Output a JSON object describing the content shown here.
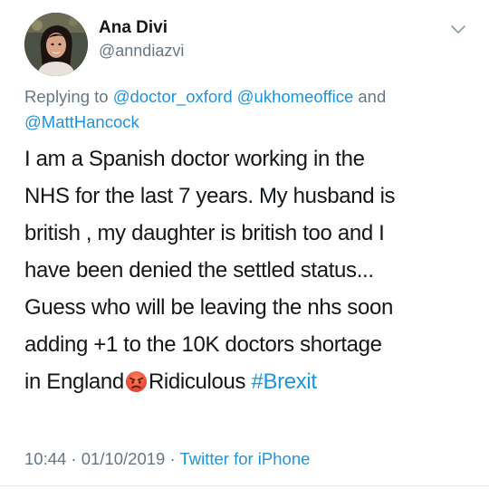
{
  "tweet": {
    "author": {
      "display_name": "Ana Divi",
      "handle": "@anndiazvi",
      "avatar_icon": "profile-photo"
    },
    "menu_icon": "chevron-down-icon",
    "reply": {
      "prefix": "Replying to ",
      "mentions": [
        "@doctor_oxford",
        "@ukhomeoffice",
        "@MattHancock"
      ],
      "separator_1": " ",
      "separator_2": " and",
      "accent_color": "#1b95e0"
    },
    "body_lines": [
      "I am a Spanish doctor working in the",
      "NHS for the last 7 years. My husband is",
      "british , my daughter is british too and I",
      "have been denied the settled status...",
      "Guess who will be leaving the nhs soon",
      "adding +1 to the 10K doctors shortage"
    ],
    "last_line": {
      "before_emoji": "in England",
      "emoji": "angry-face-emoji",
      "after_emoji": "Ridiculous ",
      "hashtag": "#Brexit"
    },
    "meta": {
      "time": "10:44",
      "dot_1": " · ",
      "date": "01/10/2019",
      "dot_2": " · ",
      "source": "Twitter for iPhone"
    }
  }
}
